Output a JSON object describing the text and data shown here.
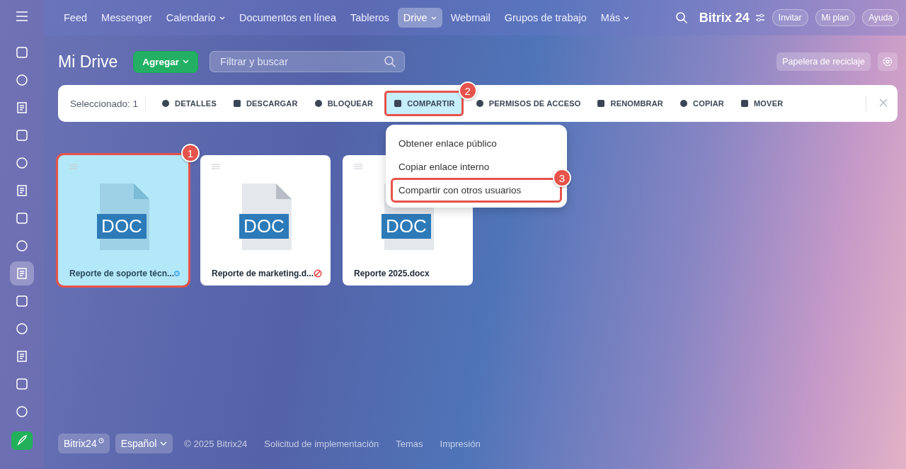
{
  "sidebar": {
    "items": [
      {
        "selected": false
      },
      {
        "selected": false
      },
      {
        "selected": false
      },
      {
        "selected": false
      },
      {
        "selected": false
      },
      {
        "selected": false
      },
      {
        "selected": false
      },
      {
        "selected": false
      },
      {
        "selected": true
      },
      {
        "selected": false
      },
      {
        "selected": false
      },
      {
        "selected": false
      },
      {
        "selected": false
      },
      {
        "selected": false
      }
    ]
  },
  "top_nav": {
    "tabs": [
      {
        "label": "Feed",
        "selected": false,
        "has_menu": false
      },
      {
        "label": "Messenger",
        "selected": false,
        "has_menu": false
      },
      {
        "label": "Calendario",
        "selected": false,
        "has_menu": true
      },
      {
        "label": "Documentos en línea",
        "selected": false,
        "has_menu": false
      },
      {
        "label": "Tableros",
        "selected": false,
        "has_menu": false
      },
      {
        "label": "Drive",
        "selected": true,
        "has_menu": true
      },
      {
        "label": "Webmail",
        "selected": false,
        "has_menu": false
      },
      {
        "label": "Grupos de trabajo",
        "selected": false,
        "has_menu": false
      },
      {
        "label": "Más",
        "selected": false,
        "has_menu": true
      }
    ],
    "logo": "Bitrix 24",
    "buttons": [
      "Invitar",
      "Mi plan",
      "Ayuda"
    ]
  },
  "header": {
    "title": "Mi Drive",
    "add_button": "Agregar",
    "search": {
      "placeholder": "Filtrar y buscar"
    },
    "trash_button": "Papelera de reciclaje"
  },
  "toolbar": {
    "selection": "Seleccionado: 1",
    "actions": [
      {
        "label": "DETALLES"
      },
      {
        "label": "DESCARGAR"
      },
      {
        "label": "BLOQUEAR"
      },
      {
        "label": "COMPARTIR",
        "callout": "2"
      },
      {
        "label": "PERMISOS DE ACCESO"
      },
      {
        "label": "RENOMBRAR"
      },
      {
        "label": "COPIAR"
      },
      {
        "label": "MOVER"
      }
    ]
  },
  "share_menu": {
    "items": [
      {
        "label": "Obtener enlace público"
      },
      {
        "label": "Copiar enlace interno"
      },
      {
        "label": "Compartir con otros usuarios",
        "callout": "3"
      }
    ]
  },
  "files": [
    {
      "name": "Reporte de soporte técn...",
      "badge": "DOC",
      "selected": true,
      "shared": true,
      "locked": false,
      "callout": "1"
    },
    {
      "name": "Reporte de marketing.d...",
      "badge": "DOC",
      "selected": false,
      "shared": false,
      "locked": true
    },
    {
      "name": "Reporte 2025.docx",
      "badge": "DOC",
      "selected": false,
      "shared": false,
      "locked": false
    }
  ],
  "footer": {
    "brand_button": "Bitrix24",
    "language": "Español",
    "copyright": "© 2025 Bitrix24",
    "links": [
      "Solicitud de implementación",
      "Temas",
      "Impresión"
    ]
  }
}
